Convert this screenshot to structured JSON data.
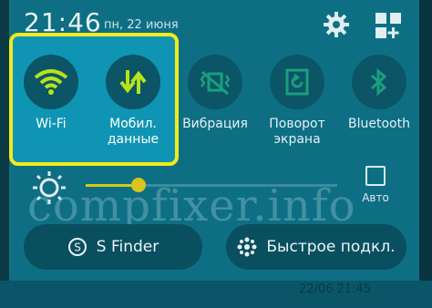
{
  "status": {
    "time": "21:46",
    "date": "пн, 22 июня"
  },
  "toggles": [
    {
      "label": "Wi-Fi",
      "icon": "wifi-icon",
      "on": true
    },
    {
      "label": "Мобил. данные",
      "icon": "mobile-data-icon",
      "on": true
    },
    {
      "label": "Вибрация",
      "icon": "vibration-icon",
      "on": false
    },
    {
      "label": "Поворот экрана",
      "icon": "screen-rotation-icon",
      "on": false
    },
    {
      "label": "Bluetooth",
      "icon": "bluetooth-icon",
      "on": false
    }
  ],
  "brightness": {
    "level": 0.21,
    "auto_label": "Авто"
  },
  "buttons": {
    "s_finder": "S Finder",
    "quick_connect": "Быстрое подкл."
  },
  "watermark": "compfixer.info",
  "footer_timestamp": "22/06 21:45",
  "colors": {
    "accent_yellow": "#f3ea1b",
    "toggle_on": "#b9e21b",
    "panel_bg": "#0e6f84"
  }
}
